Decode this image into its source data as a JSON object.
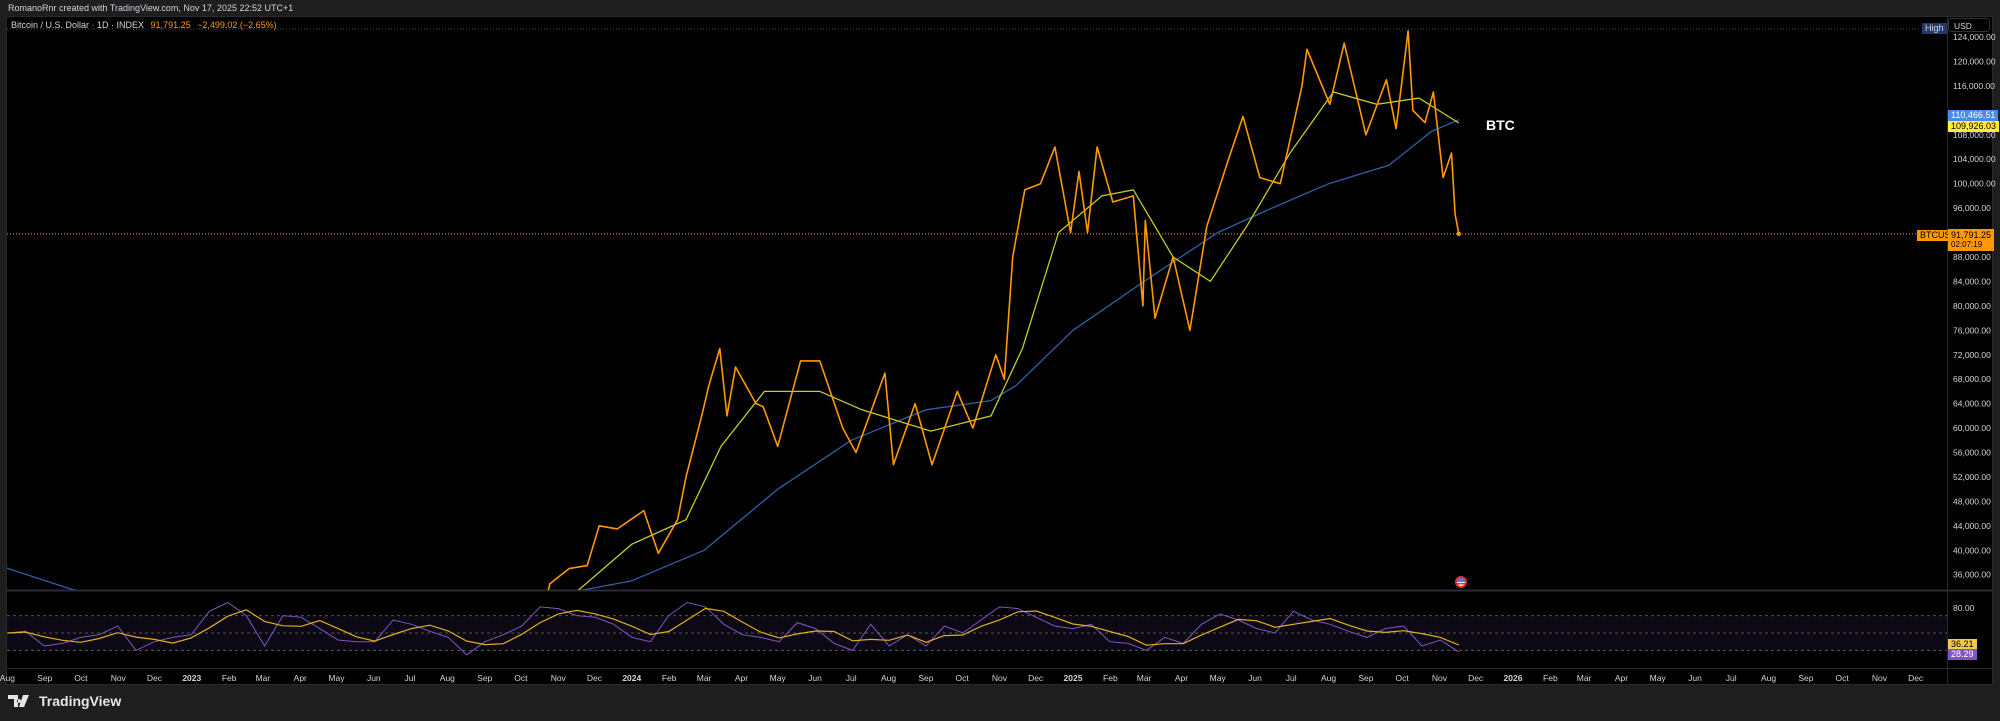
{
  "header": {
    "credit": "RomanoRnr created with TradingView.com, Nov 17, 2025 22:52 UTC+1",
    "symbol_title": "Bitcoin / U.S. Dollar · 1D · INDEX",
    "last_price": "91,791.25",
    "change": "−2,499.02 (−2.65%)"
  },
  "annotation_label": "BTC",
  "price_axis": {
    "currency": "USD",
    "high_label": "High",
    "symbol_tag": "BTCUSD",
    "last_price_tag": "91,791.25",
    "countdown": "02:07:19",
    "ma_slow_tag": "110,466.51",
    "ma_fast_tag": "109,926.03",
    "rsi_ma_tag": "36.21",
    "rsi_tag": "28.29",
    "rsi_level_label": "80.00"
  },
  "branding": "TradingView",
  "colors": {
    "price": "#ff9800",
    "ma_fast": "#c8c828",
    "ma_slow": "#2f5fa8",
    "rsi": "#7e57c2",
    "rsi_ma": "#e0b020",
    "blue_tag": "#4a8ae8",
    "yellow_tag": "#ffeb3b"
  },
  "chart_data": {
    "type": "line",
    "title": "Bitcoin / U.S. Dollar · 1D · INDEX",
    "ylabel": "USD",
    "ylim": [
      36000,
      124000
    ],
    "y_ticks": [
      124000,
      120000,
      116000,
      108000,
      104000,
      100000,
      96000,
      88000,
      84000,
      80000,
      76000,
      72000,
      68000,
      64000,
      60000,
      56000,
      52000,
      48000,
      44000,
      40000,
      36000
    ],
    "x_ticks": [
      {
        "label": "Aug",
        "date": "2022-08-01"
      },
      {
        "label": "Sep",
        "date": "2022-09-01"
      },
      {
        "label": "Oct",
        "date": "2022-10-01"
      },
      {
        "label": "Nov",
        "date": "2022-11-01"
      },
      {
        "label": "Dec",
        "date": "2022-12-01"
      },
      {
        "label": "2023",
        "date": "2023-01-01"
      },
      {
        "label": "Feb",
        "date": "2023-02-01"
      },
      {
        "label": "Mar",
        "date": "2023-03-01"
      },
      {
        "label": "Apr",
        "date": "2023-04-01"
      },
      {
        "label": "May",
        "date": "2023-05-01"
      },
      {
        "label": "Jun",
        "date": "2023-06-01"
      },
      {
        "label": "Jul",
        "date": "2023-07-01"
      },
      {
        "label": "Aug",
        "date": "2023-08-01"
      },
      {
        "label": "Sep",
        "date": "2023-09-01"
      },
      {
        "label": "Oct",
        "date": "2023-10-01"
      },
      {
        "label": "Nov",
        "date": "2023-11-01"
      },
      {
        "label": "Dec",
        "date": "2023-12-01"
      },
      {
        "label": "2024",
        "date": "2024-01-01"
      },
      {
        "label": "Feb",
        "date": "2024-02-01"
      },
      {
        "label": "Mar",
        "date": "2024-03-01"
      },
      {
        "label": "Apr",
        "date": "2024-04-01"
      },
      {
        "label": "May",
        "date": "2024-05-01"
      },
      {
        "label": "Jun",
        "date": "2024-06-01"
      },
      {
        "label": "Jul",
        "date": "2024-07-01"
      },
      {
        "label": "Aug",
        "date": "2024-08-01"
      },
      {
        "label": "Sep",
        "date": "2024-09-01"
      },
      {
        "label": "Oct",
        "date": "2024-10-01"
      },
      {
        "label": "Nov",
        "date": "2024-11-01"
      },
      {
        "label": "Dec",
        "date": "2024-12-01"
      },
      {
        "label": "2025",
        "date": "2025-01-01"
      },
      {
        "label": "Feb",
        "date": "2025-02-01"
      },
      {
        "label": "Mar",
        "date": "2025-03-01"
      },
      {
        "label": "Apr",
        "date": "2025-04-01"
      },
      {
        "label": "May",
        "date": "2025-05-01"
      },
      {
        "label": "Jun",
        "date": "2025-06-01"
      },
      {
        "label": "Jul",
        "date": "2025-07-01"
      },
      {
        "label": "Aug",
        "date": "2025-08-01"
      },
      {
        "label": "Sep",
        "date": "2025-09-01"
      },
      {
        "label": "Oct",
        "date": "2025-10-01"
      },
      {
        "label": "Nov",
        "date": "2025-11-01"
      },
      {
        "label": "Dec",
        "date": "2025-12-01"
      },
      {
        "label": "2026",
        "date": "2026-01-01"
      },
      {
        "label": "Feb",
        "date": "2026-02-01"
      },
      {
        "label": "Mar",
        "date": "2026-03-01"
      },
      {
        "label": "Apr",
        "date": "2026-04-01"
      },
      {
        "label": "May",
        "date": "2026-05-01"
      },
      {
        "label": "Jun",
        "date": "2026-06-01"
      },
      {
        "label": "Jul",
        "date": "2026-07-01"
      },
      {
        "label": "Aug",
        "date": "2026-08-01"
      },
      {
        "label": "Sep",
        "date": "2026-09-01"
      },
      {
        "label": "Oct",
        "date": "2026-10-01"
      },
      {
        "label": "Nov",
        "date": "2026-11-01"
      },
      {
        "label": "Dec",
        "date": "2026-12-01"
      }
    ],
    "series": [
      {
        "name": "BTCUSD",
        "points": [
          [
            "2023-10-20",
            30000
          ],
          [
            "2023-10-25",
            34500
          ],
          [
            "2023-11-10",
            37000
          ],
          [
            "2023-11-25",
            37500
          ],
          [
            "2023-12-05",
            44000
          ],
          [
            "2023-12-20",
            43500
          ],
          [
            "2024-01-11",
            46500
          ],
          [
            "2024-01-23",
            39500
          ],
          [
            "2024-02-08",
            45000
          ],
          [
            "2024-02-15",
            52000
          ],
          [
            "2024-02-28",
            62000
          ],
          [
            "2024-03-05",
            67000
          ],
          [
            "2024-03-14",
            73000
          ],
          [
            "2024-03-20",
            62000
          ],
          [
            "2024-03-27",
            70000
          ],
          [
            "2024-04-13",
            64000
          ],
          [
            "2024-04-19",
            63500
          ],
          [
            "2024-05-01",
            57000
          ],
          [
            "2024-05-20",
            71000
          ],
          [
            "2024-06-05",
            71000
          ],
          [
            "2024-06-24",
            60000
          ],
          [
            "2024-07-05",
            56000
          ],
          [
            "2024-07-29",
            69000
          ],
          [
            "2024-08-05",
            54000
          ],
          [
            "2024-08-23",
            64000
          ],
          [
            "2024-09-06",
            54000
          ],
          [
            "2024-09-27",
            66000
          ],
          [
            "2024-10-10",
            60000
          ],
          [
            "2024-10-29",
            72000
          ],
          [
            "2024-11-05",
            68000
          ],
          [
            "2024-11-12",
            88000
          ],
          [
            "2024-11-22",
            99000
          ],
          [
            "2024-12-05",
            100000
          ],
          [
            "2024-12-17",
            106000
          ],
          [
            "2024-12-30",
            92000
          ],
          [
            "2025-01-06",
            102000
          ],
          [
            "2025-01-13",
            92000
          ],
          [
            "2025-01-21",
            106000
          ],
          [
            "2025-02-03",
            97000
          ],
          [
            "2025-02-20",
            98000
          ],
          [
            "2025-02-28",
            80000
          ],
          [
            "2025-03-02",
            94000
          ],
          [
            "2025-03-10",
            78000
          ],
          [
            "2025-03-25",
            88000
          ],
          [
            "2025-04-08",
            76000
          ],
          [
            "2025-04-22",
            93000
          ],
          [
            "2025-05-10",
            104000
          ],
          [
            "2025-05-22",
            111000
          ],
          [
            "2025-06-05",
            101000
          ],
          [
            "2025-06-22",
            100000
          ],
          [
            "2025-07-10",
            116000
          ],
          [
            "2025-07-14",
            122000
          ],
          [
            "2025-08-02",
            113000
          ],
          [
            "2025-08-14",
            123000
          ],
          [
            "2025-09-01",
            108000
          ],
          [
            "2025-09-18",
            117000
          ],
          [
            "2025-09-26",
            109000
          ],
          [
            "2025-10-06",
            125000
          ],
          [
            "2025-10-10",
            112000
          ],
          [
            "2025-10-20",
            110000
          ],
          [
            "2025-10-27",
            115000
          ],
          [
            "2025-11-04",
            101000
          ],
          [
            "2025-11-11",
            105000
          ],
          [
            "2025-11-14",
            95000
          ],
          [
            "2025-11-17",
            91791.25
          ]
        ]
      },
      {
        "name": "MA fast",
        "points": [
          [
            "2023-11-15",
            33000
          ],
          [
            "2024-01-01",
            41000
          ],
          [
            "2024-02-15",
            45000
          ],
          [
            "2024-03-15",
            57000
          ],
          [
            "2024-04-20",
            66000
          ],
          [
            "2024-06-05",
            66000
          ],
          [
            "2024-07-10",
            63000
          ],
          [
            "2024-09-05",
            59500
          ],
          [
            "2024-10-25",
            62000
          ],
          [
            "2024-11-20",
            73000
          ],
          [
            "2024-12-20",
            92000
          ],
          [
            "2025-01-25",
            98000
          ],
          [
            "2025-02-20",
            99000
          ],
          [
            "2025-03-25",
            88000
          ],
          [
            "2025-04-25",
            84000
          ],
          [
            "2025-05-25",
            93000
          ],
          [
            "2025-06-30",
            105000
          ],
          [
            "2025-08-05",
            115000
          ],
          [
            "2025-09-10",
            113000
          ],
          [
            "2025-10-15",
            114000
          ],
          [
            "2025-11-17",
            109926.03
          ]
        ]
      },
      {
        "name": "MA slow",
        "points": [
          [
            "2022-07-25",
            37500
          ],
          [
            "2022-09-25",
            33500
          ],
          [
            "2023-06-01",
            27000
          ],
          [
            "2024-01-01",
            35000
          ],
          [
            "2024-03-01",
            40000
          ],
          [
            "2024-05-01",
            50000
          ],
          [
            "2024-07-01",
            58000
          ],
          [
            "2024-09-01",
            63000
          ],
          [
            "2024-10-25",
            64500
          ],
          [
            "2024-11-15",
            67000
          ],
          [
            "2025-01-01",
            76000
          ],
          [
            "2025-03-01",
            84000
          ],
          [
            "2025-05-01",
            92000
          ],
          [
            "2025-06-15",
            96000
          ],
          [
            "2025-08-01",
            100000
          ],
          [
            "2025-09-20",
            103000
          ],
          [
            "2025-10-25",
            108500
          ],
          [
            "2025-11-17",
            110466.51
          ]
        ]
      }
    ],
    "rsi": {
      "levels": [
        70,
        50,
        30
      ],
      "start": "2022-08-01",
      "end": "2025-11-17",
      "values": [
        50,
        52,
        35,
        38,
        45,
        48,
        58,
        30,
        40,
        45,
        48,
        75,
        85,
        70,
        35,
        70,
        68,
        55,
        42,
        40,
        40,
        65,
        60,
        52,
        45,
        25,
        40,
        48,
        58,
        80,
        78,
        70,
        68,
        60,
        45,
        40,
        70,
        85,
        80,
        60,
        48,
        45,
        40,
        62,
        55,
        38,
        30,
        60,
        35,
        48,
        35,
        58,
        50,
        65,
        80,
        78,
        68,
        58,
        55,
        60,
        40,
        38,
        30,
        45,
        38,
        60,
        72,
        65,
        55,
        50,
        75,
        65,
        60,
        52,
        45,
        55,
        58,
        35,
        42,
        28.29
      ],
      "ma_last": 36.21
    }
  }
}
